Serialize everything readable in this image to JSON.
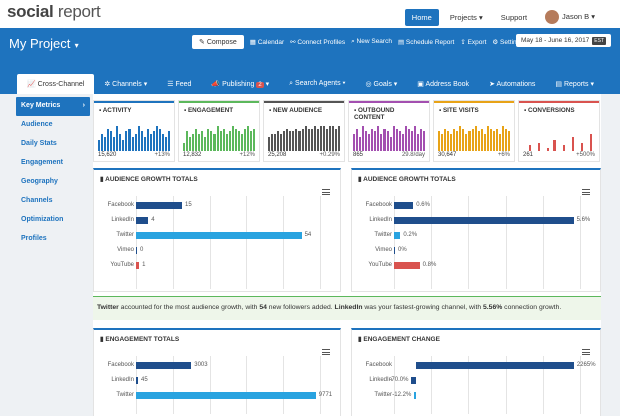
{
  "logo": {
    "soc": "social",
    "rep": " report"
  },
  "topnav": {
    "home": "Home",
    "projects": "Projects ▾",
    "support": "Support",
    "user": "Jason B ▾"
  },
  "header": {
    "project": "My Project",
    "compose": "Compose",
    "calendar": "Calendar",
    "connect": "Connect Profiles",
    "new_search": "New Search",
    "schedule_report": "Schedule Report",
    "export": "Export",
    "settings": "Settings ▾",
    "date_range": "May 18 - June 16, 2017",
    "tz": "EST"
  },
  "subnav": {
    "cross_channel": "Cross-Channel",
    "channels": "Channels ▾",
    "feed": "Feed",
    "publishing": "Publishing",
    "publishing_badge": "2",
    "search_agents": "Search Agents ▾",
    "goals": "Goals ▾",
    "address_book": "Address Book",
    "automations": "Automations",
    "reports": "Reports ▾"
  },
  "sidebar": [
    "Key Metrics",
    "Audience",
    "Daily Stats",
    "Engagement",
    "Geography",
    "Channels",
    "Optimization",
    "Profiles"
  ],
  "metrics": [
    {
      "title": "ACTIVITY",
      "value": "15,620",
      "change": "+13%",
      "color": "#1e73be",
      "icon": "bar-chart-icon"
    },
    {
      "title": "ENGAGEMENT",
      "value": "12,832",
      "change": "+12%",
      "color": "#5cb85c",
      "icon": "heart-icon"
    },
    {
      "title": "NEW AUDIENCE",
      "value": "25,208",
      "change": "+0.29%",
      "color": "#555",
      "icon": "user-icon"
    },
    {
      "title": "OUTBOUND CONTENT",
      "value": "865",
      "change": "29.8/day",
      "color": "#a34fb0",
      "icon": "megaphone-icon"
    },
    {
      "title": "SITE VISITS",
      "value": "30,647",
      "change": "+6%",
      "color": "#e8a317",
      "icon": "globe-icon"
    },
    {
      "title": "CONVERSIONS",
      "value": "261",
      "change": "+500%",
      "color": "#d9534f",
      "icon": "flag-icon"
    }
  ],
  "panels": {
    "growth_totals": {
      "title": "AUDIENCE GROWTH TOTALS",
      "rows": [
        {
          "label": "Facebook",
          "value": 15,
          "text": "15",
          "color": "#1f4e8c"
        },
        {
          "label": "LinkedIn",
          "value": 4,
          "text": "4",
          "color": "#1f4e8c"
        },
        {
          "label": "Twitter",
          "value": 54,
          "text": "54",
          "color": "#29a3e0"
        },
        {
          "label": "Vimeo",
          "value": 0,
          "text": "0",
          "color": "#1f4e8c"
        },
        {
          "label": "YouTube",
          "value": 1,
          "text": "1",
          "color": "#d9534f"
        }
      ],
      "max": 60
    },
    "growth_pct": {
      "title": "AUDIENCE GROWTH TOTALS",
      "rows": [
        {
          "label": "Facebook",
          "value": 0.6,
          "text": "0.6%",
          "color": "#1f4e8c"
        },
        {
          "label": "LinkedIn",
          "value": 5.6,
          "text": "5.6%",
          "color": "#1f4e8c"
        },
        {
          "label": "Twitter",
          "value": 0.2,
          "text": "0.2%",
          "color": "#29a3e0"
        },
        {
          "label": "Vimeo",
          "value": 0,
          "text": "0%",
          "color": "#1f4e8c"
        },
        {
          "label": "YouTube",
          "value": 0.8,
          "text": "0.8%",
          "color": "#d9534f"
        }
      ],
      "max": 5.8
    },
    "summary": {
      "p1": "Twitter",
      "t1": " accounted for the most audience growth, with ",
      "p2": "54",
      "t2": " new followers added. ",
      "p3": "LinkedIn",
      "t3": " was your fastest-growing channel, with ",
      "p4": "5.56%",
      "t4": " connection growth."
    },
    "engagement_totals": {
      "title": "ENGAGEMENT TOTALS",
      "rows": [
        {
          "label": "Facebook",
          "value": 3003,
          "text": "3003",
          "color": "#1f4e8c"
        },
        {
          "label": "LinkedIn",
          "value": 45,
          "text": "45",
          "color": "#1f4e8c"
        },
        {
          "label": "Twitter",
          "value": 9771,
          "text": "9771",
          "color": "#29a3e0"
        }
      ],
      "max": 10000
    },
    "engagement_change": {
      "title": "ENGAGEMENT CHANGE",
      "rows": [
        {
          "label": "Facebook",
          "value": 2265,
          "text": "2265%",
          "color": "#1f4e8c"
        },
        {
          "label": "LinkedIn",
          "value": -70,
          "text": "-70.0%",
          "color": "#1f4e8c"
        },
        {
          "label": "Twitter",
          "value": -12.2,
          "text": "-12.2%",
          "color": "#29a3e0"
        }
      ],
      "max": 2300
    }
  }
}
